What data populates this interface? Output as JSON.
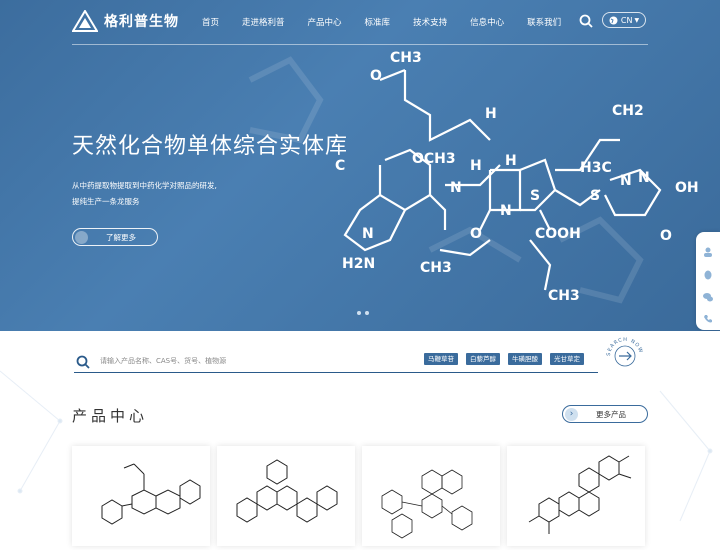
{
  "header": {
    "logo_text": "格利普生物",
    "nav": [
      "首页",
      "走进格利普",
      "产品中心",
      "标准库",
      "技术支持",
      "信息中心",
      "联系我们"
    ],
    "lang": "CN"
  },
  "hero": {
    "title": "天然化合物单体综合实体库",
    "subtitle_lines": [
      "从中药提取物提取到中药化学对照品的研发,",
      "提纯生产一条龙服务"
    ],
    "button_label": "了解更多",
    "slide_count": 2
  },
  "search": {
    "placeholder": "请输入产品名称、CAS号、货号、植物源",
    "tags": [
      "马鞭草苷",
      "白藜芦醇",
      "牛磺胆酸",
      "光甘草定"
    ],
    "badge_text": "SEARCH NOW"
  },
  "products": {
    "section_title": "产品中心",
    "more_label": "更多产品",
    "cards": [
      "product-card-1",
      "product-card-2",
      "product-card-3",
      "product-card-4"
    ]
  },
  "colors": {
    "hero_bg": "#4a7fb2",
    "accent": "#3a6b9c"
  }
}
